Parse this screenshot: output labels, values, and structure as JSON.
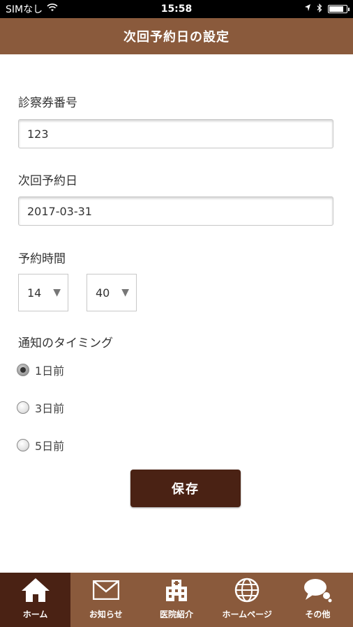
{
  "status_bar": {
    "carrier": "SIMなし",
    "time": "15:58",
    "battery_level": 0.8
  },
  "header": {
    "title": "次回予約日の設定"
  },
  "form": {
    "card_number": {
      "label": "診察券番号",
      "value": "123"
    },
    "next_date": {
      "label": "次回予約日",
      "value": "2017-03-31"
    },
    "time": {
      "label": "予約時間",
      "hour": "14",
      "minute": "40"
    },
    "notify": {
      "label": "通知のタイミング",
      "options": [
        {
          "label": "1日前",
          "checked": true
        },
        {
          "label": "3日前",
          "checked": false
        },
        {
          "label": "5日前",
          "checked": false
        }
      ]
    },
    "save_label": "保存"
  },
  "tabs": [
    {
      "label": "ホーム",
      "icon": "home-icon",
      "active": true
    },
    {
      "label": "お知らせ",
      "icon": "mail-icon",
      "active": false
    },
    {
      "label": "医院紹介",
      "icon": "hospital-icon",
      "active": false
    },
    {
      "label": "ホームページ",
      "icon": "globe-icon",
      "active": false
    },
    {
      "label": "その他",
      "icon": "chat-bubbles-icon",
      "active": false
    }
  ],
  "colors": {
    "brand": "#8a5a3c",
    "brand_dark": "#4a2214"
  }
}
